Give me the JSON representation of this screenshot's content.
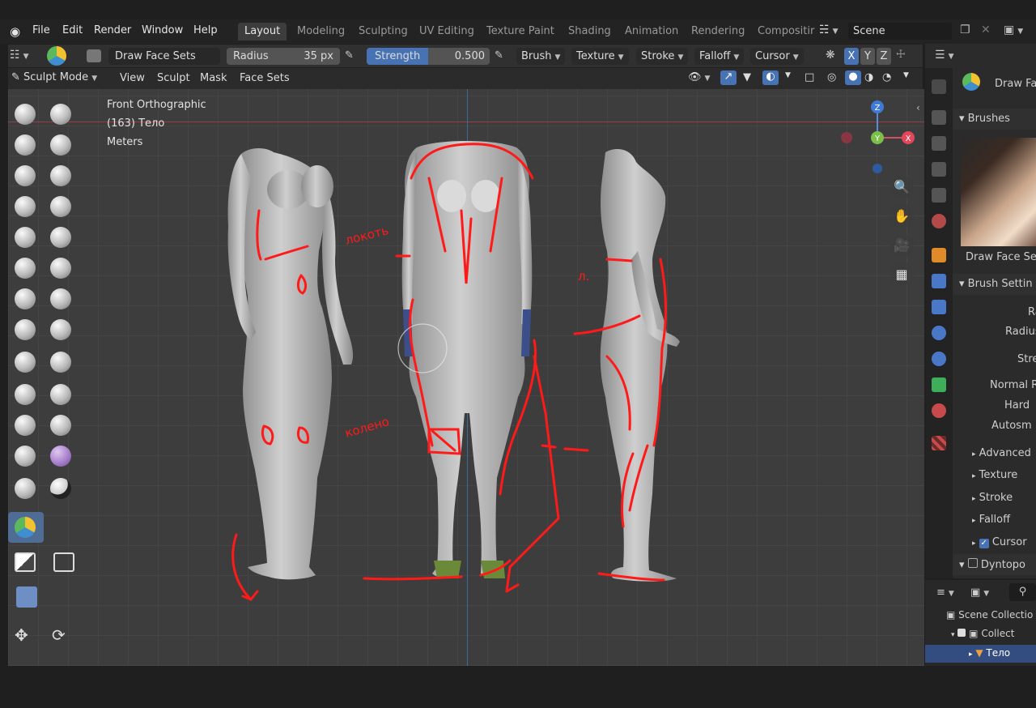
{
  "menu": {
    "file": "File",
    "edit": "Edit",
    "render": "Render",
    "window": "Window",
    "help": "Help"
  },
  "workspaces": [
    "Layout",
    "Modeling",
    "Sculpting",
    "UV Editing",
    "Texture Paint",
    "Shading",
    "Animation",
    "Rendering",
    "Compositir"
  ],
  "scene": {
    "label": "Scene"
  },
  "header": {
    "brush_name": "Draw Face Sets",
    "radius_label": "Radius",
    "radius_value": "35 px",
    "strength_label": "Strength",
    "strength_value": "0.500",
    "brush_dd": "Brush",
    "texture_dd": "Texture",
    "stroke_dd": "Stroke",
    "falloff_dd": "Falloff",
    "cursor_dd": "Cursor",
    "sym_x": "X",
    "sym_y": "Y",
    "sym_z": "Z"
  },
  "modebar": {
    "mode": "Sculpt Mode",
    "view": "View",
    "sculpt": "Sculpt",
    "mask": "Mask",
    "face_sets": "Face Sets"
  },
  "viewport": {
    "projection": "Front Orthographic",
    "object": "(163) Тело",
    "units": "Meters",
    "annotation_1": "локоть",
    "annotation_2": "колено",
    "annotation_3": "л."
  },
  "gizmo": {
    "z": "Z",
    "y": "Y",
    "x": "X"
  },
  "right_panel": {
    "brush_title": "Draw Fac",
    "brushes": "Brushes",
    "preview_label": "Draw Face Set",
    "brush_settings": "Brush Settin",
    "rows": [
      "Ra",
      "Radius",
      "Stre",
      "Normal Ra",
      "Hard",
      "Autosm"
    ],
    "subpanels": [
      "Advanced",
      "Texture",
      "Stroke",
      "Falloff",
      "Cursor"
    ],
    "dyntopo": "Dyntopo"
  },
  "outliner": {
    "scene_collection": "Scene Collectio",
    "collection": "Collect",
    "object": "Тело"
  },
  "colors": {
    "accent": "#4772b3",
    "annotation": "#ff1a1a",
    "viewport_bg": "#3d3d3d"
  }
}
